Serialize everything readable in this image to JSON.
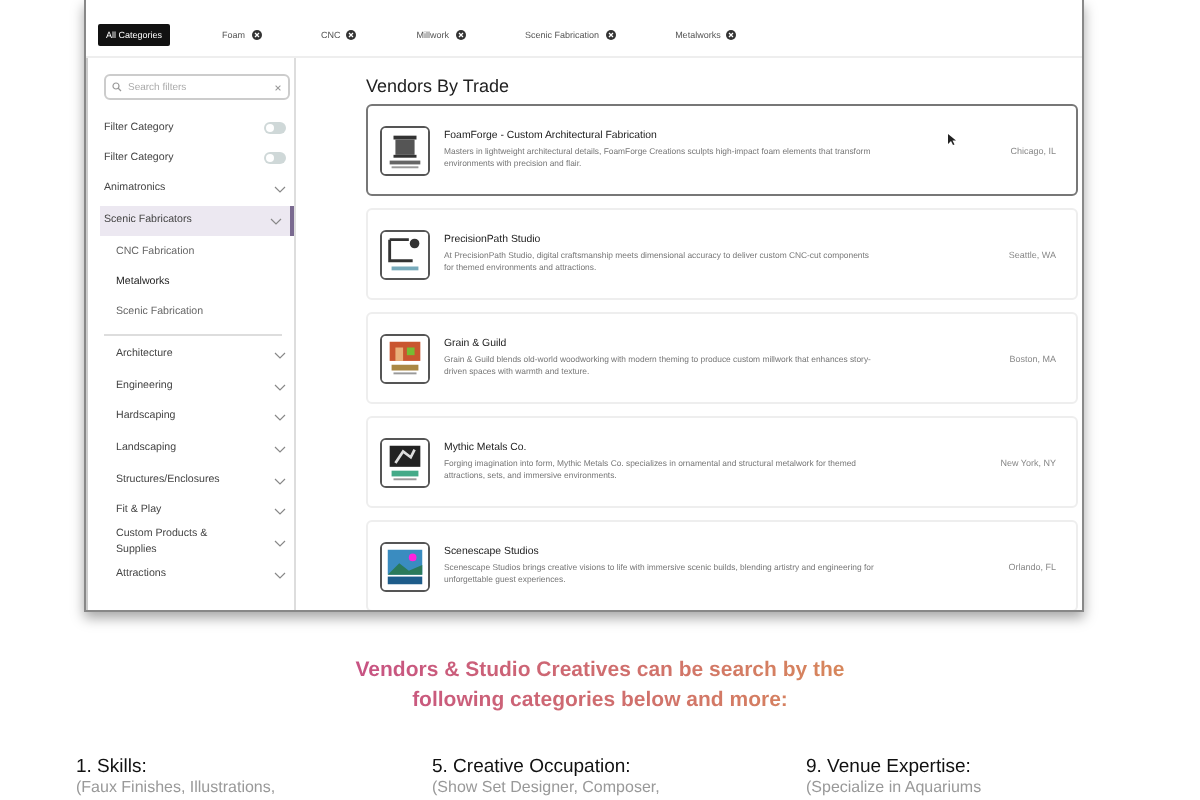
{
  "chips": [
    {
      "label": "All Categories",
      "selected": true
    },
    {
      "label": "Foam",
      "selected": false
    },
    {
      "label": "CNC",
      "selected": false
    },
    {
      "label": "Millwork",
      "selected": false
    },
    {
      "label": "Scenic Fabrication",
      "selected": false
    },
    {
      "label": "Metalworks",
      "selected": false
    }
  ],
  "sidebar": {
    "search": {
      "placeholder": "Search filters"
    },
    "toggles": [
      {
        "label": "Filter Category",
        "on": false
      },
      {
        "label": "Filter Category",
        "on": false
      }
    ],
    "categories": [
      {
        "label": "Animatronics",
        "selected": false
      },
      {
        "label": "Scenic Fabricators",
        "selected": true,
        "children": [
          {
            "label": "CNC Fabrication",
            "selected": false
          },
          {
            "label": "Metalworks",
            "selected": true
          },
          {
            "label": "Scenic Fabrication",
            "selected": false
          }
        ]
      },
      {
        "label": "Architecture",
        "selected": false
      },
      {
        "label": "Engineering",
        "selected": false
      },
      {
        "label": "Hardscaping",
        "selected": false
      },
      {
        "label": "Landscaping",
        "selected": false
      },
      {
        "label": "Structures/Enclosures",
        "selected": false
      },
      {
        "label": "Fit & Play",
        "selected": false
      },
      {
        "label": "Custom Products & Supplies",
        "selected": false
      },
      {
        "label": "Attractions",
        "selected": false
      }
    ]
  },
  "vendors": {
    "title": "Vendors By Trade",
    "items": [
      {
        "kind": "column",
        "name": "FoamForge - Custom Architectural Fabrication",
        "description": "Masters in lightweight architectural details, FoamForge Creations sculpts high-impact foam elements that transform environments with precision and flair.",
        "location": "Chicago, IL",
        "selected": true
      },
      {
        "kind": "frame",
        "name": "PrecisionPath Studio",
        "description": "At PrecisionPath Studio, digital craftsmanship meets dimensional accuracy to deliver custom CNC-cut components for themed environments and attractions.",
        "location": "Seattle, WA",
        "selected": false
      },
      {
        "kind": "shop",
        "name": "Grain & Guild",
        "description": "Grain & Guild blends old-world woodworking with modern theming to produce custom millwork that enhances story-driven spaces with warmth and texture.",
        "location": "Boston, MA",
        "selected": false
      },
      {
        "kind": "metal",
        "name": "Mythic Metals Co.",
        "description": "Forging imagination into form, Mythic Metals Co. specializes in ornamental and structural metalwork for themed attractions, sets, and immersive environments.",
        "location": "New York, NY",
        "selected": false
      },
      {
        "kind": "landscape",
        "name": "Scenescape Studios",
        "description": "Scenescape Studios brings creative visions to life with immersive scenic builds, blending artistry and engineering for unforgettable guest experiences.",
        "location": "Orlando, FL",
        "selected": false
      }
    ]
  },
  "promo": {
    "heading": "Vendors & Studio Creatives can be search by the following categories below and more:",
    "columns": [
      {
        "title": "1. Skills:",
        "text": "(Faux Finishes, Illustrations,"
      },
      {
        "title": "5. Creative Occupation:",
        "text": "(Show Set Designer, Composer,"
      },
      {
        "title": "9. Venue Expertise:",
        "text": "(Specialize in Aquariums"
      }
    ]
  }
}
